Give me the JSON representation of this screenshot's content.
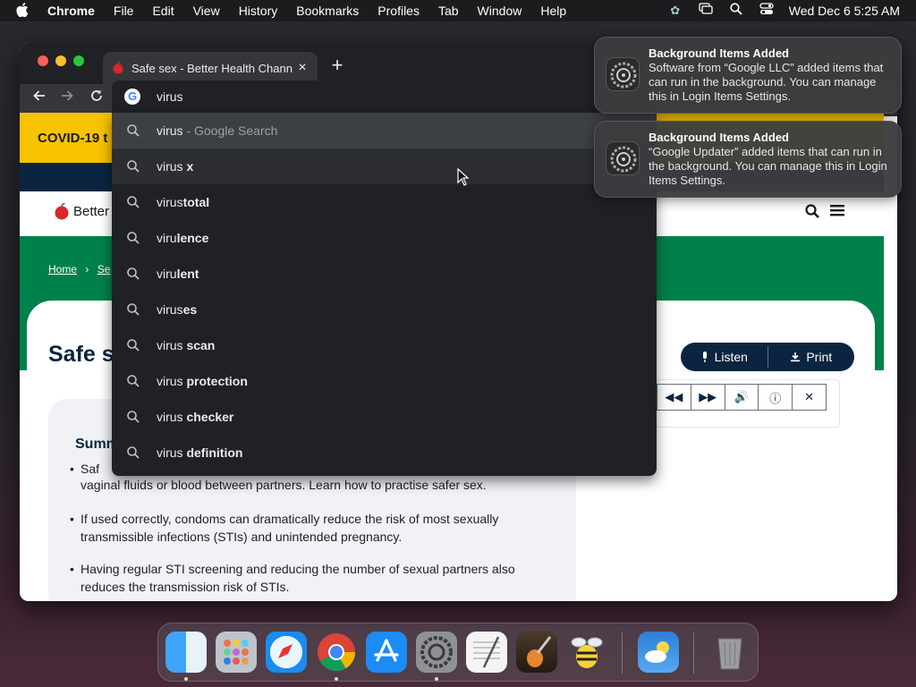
{
  "menubar": {
    "apple": "",
    "app_name": "Chrome",
    "menus": [
      "File",
      "Edit",
      "View",
      "History",
      "Bookmarks",
      "Profiles",
      "Tab",
      "Window",
      "Help"
    ],
    "clock": "Wed Dec 6  5:25 AM"
  },
  "browser": {
    "tab_title": "Safe sex - Better Health Chann",
    "tab_close": "×",
    "new_tab": "+",
    "omnibox_value": "virus",
    "suggestions": [
      {
        "prefix": "virus",
        "bold": "",
        "sub": " - Google Search"
      },
      {
        "prefix": "virus",
        "bold": " x",
        "sub": ""
      },
      {
        "prefix": "virus",
        "bold": "total",
        "sub": ""
      },
      {
        "prefix": "viru",
        "bold": "lence",
        "sub": ""
      },
      {
        "prefix": "viru",
        "bold": "lent",
        "sub": ""
      },
      {
        "prefix": "virus",
        "bold": "es",
        "sub": ""
      },
      {
        "prefix": "virus",
        "bold": " scan",
        "sub": ""
      },
      {
        "prefix": "virus",
        "bold": " protection",
        "sub": ""
      },
      {
        "prefix": "virus",
        "bold": " checker",
        "sub": ""
      },
      {
        "prefix": "virus",
        "bold": " definition",
        "sub": ""
      }
    ]
  },
  "page": {
    "covid_banner": "COVID-19 t",
    "logo_text": "Better",
    "breadcrumb_home": "Home",
    "breadcrumb_sep": "›",
    "breadcrumb_next": "Se",
    "title": "Safe s",
    "listen_label": "Listen",
    "print_label": "Print",
    "summary_title": "Summ",
    "bullets": [
      "Saf",
      "vaginal fluids or blood between partners. Learn how to practise safer sex.",
      "If used correctly, condoms can dramatically reduce the risk of most sexually transmissible infections (STIs) and unintended pregnancy.",
      "Having regular STI screening and reducing the number of sexual partners also reduces the transmission risk of STIs."
    ]
  },
  "notifications": [
    {
      "title": "Background Items Added",
      "body": "Software from “Google LLC” added items that can run in the background. You can manage this in Login Items Settings."
    },
    {
      "title": "Background Items Added",
      "body": "“Google Updater” added items that can run in the background. You can manage this in Login Items Settings."
    }
  ],
  "dock": [
    "finder-icon",
    "launchpad-icon",
    "safari-icon",
    "chrome-icon",
    "app-store-icon",
    "system-settings-icon",
    "textedit-icon",
    "garageband-icon",
    "cyberduck-icon",
    "weather-icon",
    "trash-icon"
  ],
  "colors": {
    "green": "#00804a",
    "navy": "#0b2541",
    "yellow": "#f7c200",
    "chrome_dark": "#202124"
  }
}
